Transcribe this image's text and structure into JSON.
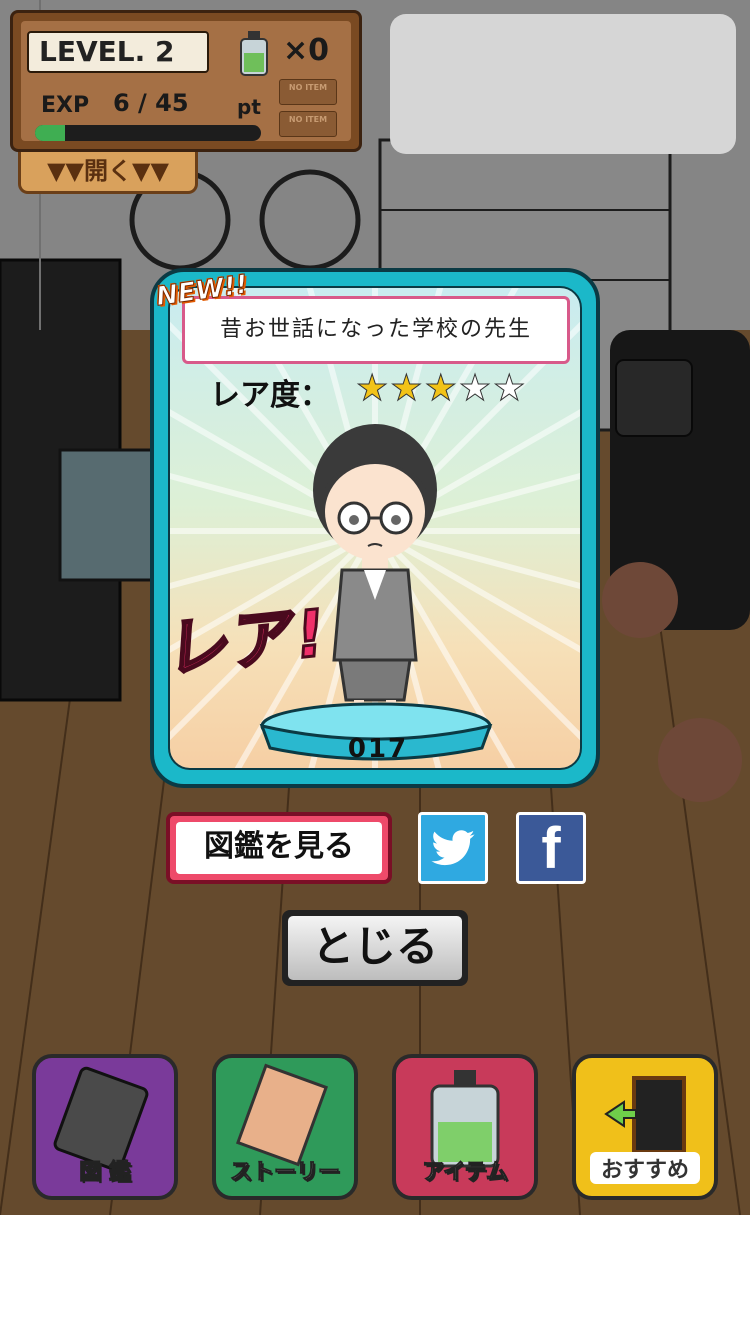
{
  "hud": {
    "level_text": "LEVEL. 2",
    "item_count": "×0",
    "exp_label": "EXP",
    "exp_value": "6 / 45",
    "exp_unit": "pt",
    "exp_progress": 0.133,
    "no_item_1": "NO ITEM",
    "no_item_2": "NO ITEM",
    "open_label": "▼▼開く▼▼"
  },
  "card": {
    "new_badge": "NEW!!",
    "character_name": "昔お世話になった学校の先生",
    "rarity_label": "レア度：",
    "rarity_stars": 3,
    "rarity_max": 5,
    "rare_banner": "レア!",
    "number": "017"
  },
  "actions": {
    "zukan_label": "図鑑を見る",
    "twitter_icon": "twitter-icon",
    "facebook_label": "f",
    "close_label": "とじる"
  },
  "menu": [
    {
      "label": "図 鑑",
      "color": "#7a3a9a"
    },
    {
      "label": "ストーリー",
      "color": "#2f9a5a"
    },
    {
      "label": "アイテム",
      "color": "#c83a5a"
    },
    {
      "label": "おすすめ",
      "color": "#f0c01a"
    }
  ]
}
